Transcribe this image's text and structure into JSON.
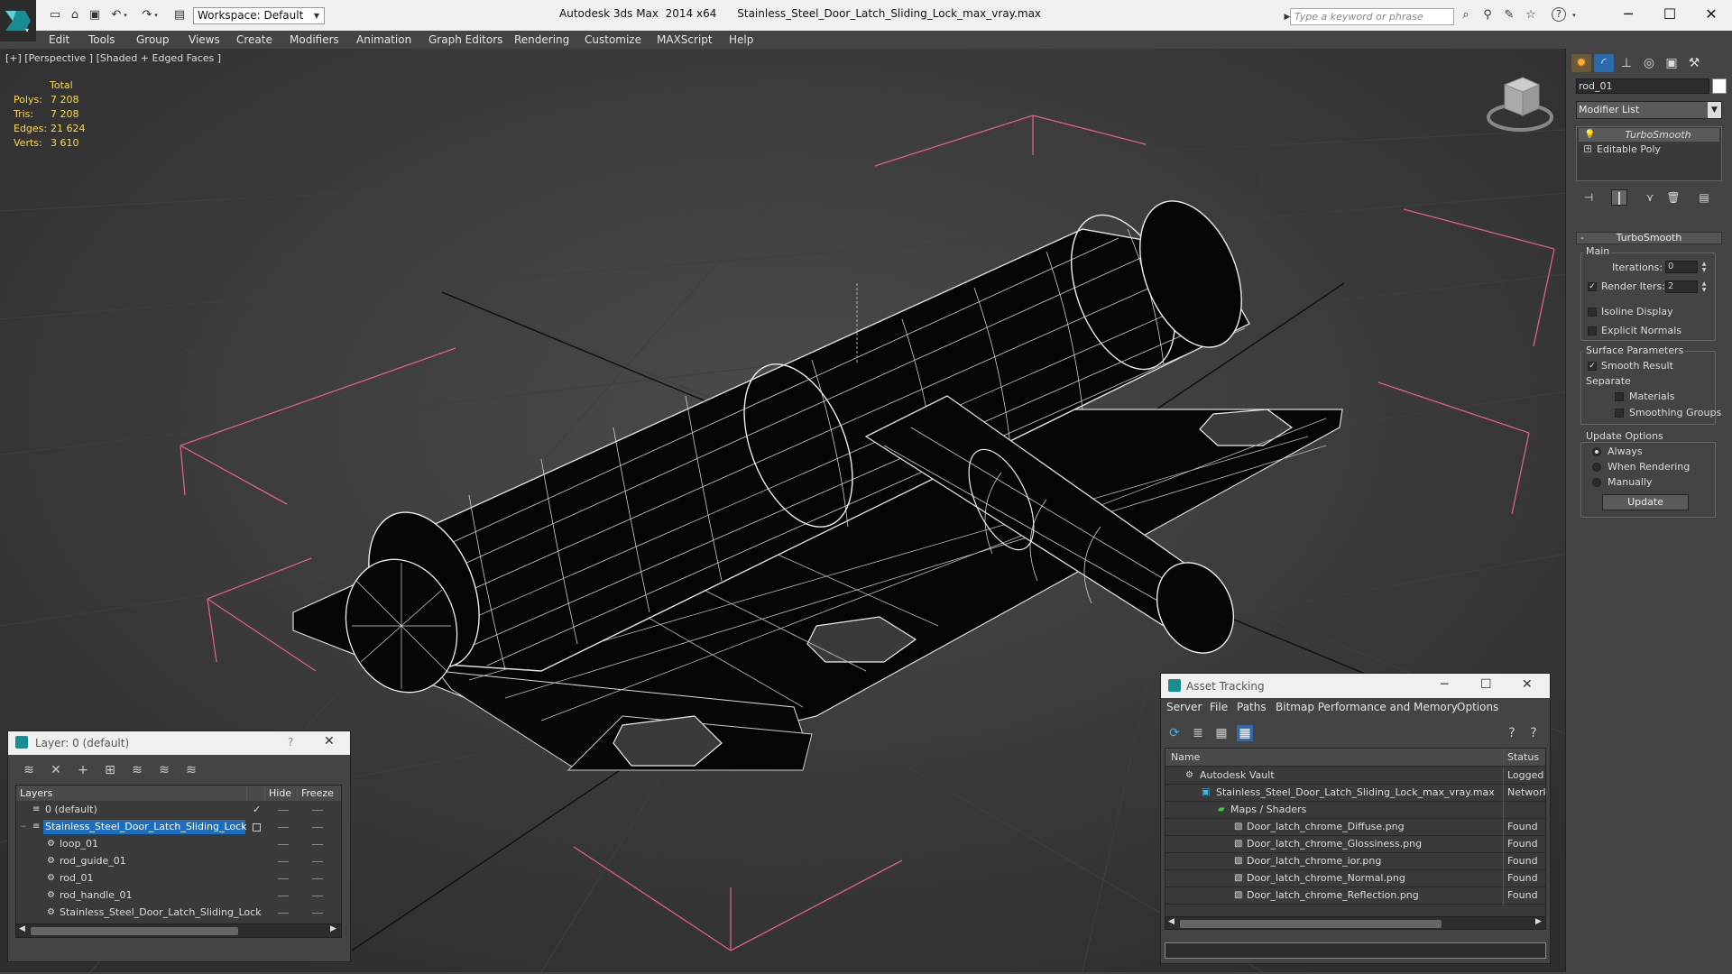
{
  "title_bar": {
    "workspace_label": "Workspace: Default",
    "app_title": "Autodesk 3ds Max  2014 x64",
    "file_title": "Stainless_Steel_Door_Latch_Sliding_Lock_max_vray.max",
    "search_placeholder": "Type a keyword or phrase"
  },
  "menu": [
    "Edit",
    "Tools",
    "Group",
    "Views",
    "Create",
    "Modifiers",
    "Animation",
    "Graph Editors",
    "Rendering",
    "Customize",
    "MAXScript",
    "Help"
  ],
  "viewport": {
    "label": "[+] [Perspective ] [Shaded + Edged Faces ]",
    "stats_header": "Total",
    "stats": [
      {
        "label": "Polys:",
        "value": "7 208"
      },
      {
        "label": "Tris:",
        "value": "7 208"
      },
      {
        "label": "Edges:",
        "value": "21 624"
      },
      {
        "label": "Verts:",
        "value": "3 610"
      }
    ]
  },
  "command_panel": {
    "object_name": "rod_01",
    "modifier_list": "Modifier List",
    "stack": [
      "TurboSmooth",
      "Editable Poly"
    ],
    "turbosmooth": {
      "title": "TurboSmooth",
      "main_group": "Main",
      "iterations_label": "Iterations:",
      "iterations_value": "0",
      "render_iters_label": "Render Iters:",
      "render_iters_value": "2",
      "render_iters_checked": "true",
      "isoline_label": "Isoline Display",
      "explicit_normals_label": "Explicit Normals",
      "surface_group": "Surface Parameters",
      "smooth_result_label": "Smooth Result",
      "separate_label": "Separate",
      "materials_label": "Materials",
      "smoothing_groups_label": "Smoothing Groups",
      "update_group": "Update Options",
      "always_label": "Always",
      "when_rendering_label": "When Rendering",
      "manually_label": "Manually",
      "update_button": "Update"
    }
  },
  "layer_dialog": {
    "title": "Layer: 0 (default)",
    "help": "?",
    "col_layers": "Layers",
    "col_hide": "Hide",
    "col_freeze": "Freeze",
    "rows": [
      {
        "name": "0 (default)"
      },
      {
        "name": "Stainless_Steel_Door_Latch_Sliding_Lock"
      },
      {
        "name": "loop_01"
      },
      {
        "name": "rod_guide_01"
      },
      {
        "name": "rod_01"
      },
      {
        "name": "rod_handle_01"
      },
      {
        "name": "Stainless_Steel_Door_Latch_Sliding_Lock"
      }
    ]
  },
  "asset_tracking": {
    "title": "Asset Tracking",
    "menu": [
      "Server",
      "File",
      "Paths",
      "Bitmap Performance and Memory",
      "Options"
    ],
    "col_name": "Name",
    "col_status": "Status",
    "rows": [
      {
        "name": "Autodesk Vault",
        "status": "Logged Ou"
      },
      {
        "name": "Stainless_Steel_Door_Latch_Sliding_Lock_max_vray.max",
        "status": "Network"
      },
      {
        "name": "Maps / Shaders",
        "status": ""
      },
      {
        "name": "Door_latch_chrome_Diffuse.png",
        "status": "Found"
      },
      {
        "name": "Door_latch_chrome_Glossiness.png",
        "status": "Found"
      },
      {
        "name": "Door_latch_chrome_ior.png",
        "status": "Found"
      },
      {
        "name": "Door_latch_chrome_Normal.png",
        "status": "Found"
      },
      {
        "name": "Door_latch_chrome_Reflection.png",
        "status": "Found"
      }
    ]
  },
  "colors": {
    "stats_yellow": "#ffd84a",
    "selection_blue": "#1c6ebd",
    "gizmo_pink": "#e06080"
  }
}
